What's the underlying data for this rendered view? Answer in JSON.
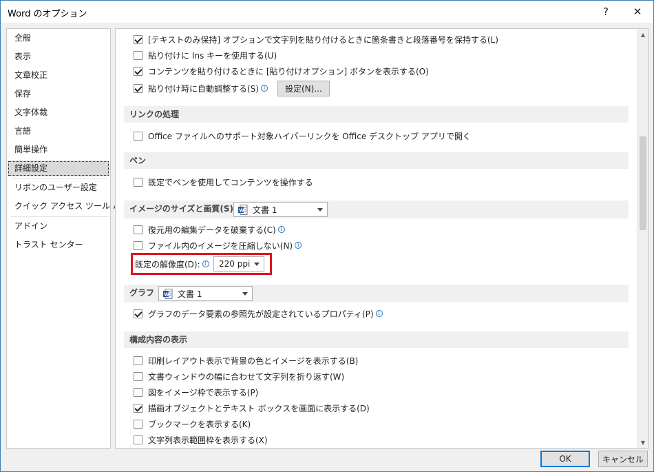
{
  "window": {
    "title": "Word のオプション",
    "help": "?",
    "close": "✕"
  },
  "sidebar": {
    "items": [
      {
        "label": "全般"
      },
      {
        "label": "表示"
      },
      {
        "label": "文章校正"
      },
      {
        "label": "保存"
      },
      {
        "label": "文字体裁"
      },
      {
        "label": "言語"
      },
      {
        "label": "簡単操作"
      },
      {
        "label": "詳細設定",
        "selected": true
      },
      {
        "label": "リボンのユーザー設定"
      },
      {
        "label": "クイック アクセス ツール バー"
      },
      {
        "label": "アドイン"
      },
      {
        "label": "トラスト センター"
      }
    ]
  },
  "main": {
    "paste": {
      "keep_bullets": {
        "label": "[テキストのみ保持] オプションで文字列を貼り付けるときに箇条書きと段落番号を保持する(L)",
        "checked": true
      },
      "ins_key": {
        "label": "貼り付けに Ins キーを使用する(U)",
        "checked": false
      },
      "show_paste_options": {
        "label": "コンテンツを貼り付けるときに [貼り付けオプション] ボタンを表示する(O)",
        "checked": true
      },
      "smart_cut": {
        "label": "貼り付け時に自動調整する(S)",
        "checked": true
      },
      "settings_button": "設定(N)..."
    },
    "link": {
      "header": "リンクの処理",
      "open_office": {
        "label": "Office ファイルへのサポート対象ハイパーリンクを Office デスクトップ アプリで開く",
        "checked": false
      }
    },
    "pen": {
      "header": "ペン",
      "use_pen": {
        "label": "既定でペンを使用してコンテンツを操作する",
        "checked": false
      }
    },
    "image": {
      "header": "イメージのサイズと画質(S)",
      "document": "文書 1",
      "discard_edit": {
        "label": "復元用の編集データを破棄する(C)",
        "checked": false
      },
      "no_compress": {
        "label": "ファイル内のイメージを圧縮しない(N)",
        "checked": false
      },
      "resolution_label": "既定の解像度(D):",
      "resolution_value": "220 ppi"
    },
    "chart": {
      "header": "グラフ",
      "document": "文書 1",
      "properties_follow": {
        "label": "グラフのデータ要素の参照先が設定されているプロパティ(P)",
        "checked": true
      }
    },
    "display": {
      "header": "構成内容の表示",
      "items": [
        {
          "label": "印刷レイアウト表示で背景の色とイメージを表示する(B)",
          "checked": false
        },
        {
          "label": "文書ウィンドウの幅に合わせて文字列を折り返す(W)",
          "checked": false
        },
        {
          "label": "図をイメージ枠で表示する(P)",
          "checked": false
        },
        {
          "label": "描画オブジェクトとテキスト ボックスを画面に表示する(D)",
          "checked": true
        },
        {
          "label": "ブックマークを表示する(K)",
          "checked": false
        },
        {
          "label": "文字列表示範囲枠を表示する(X)",
          "checked": false
        }
      ]
    }
  },
  "footer": {
    "ok": "OK",
    "cancel": "キャンセル"
  },
  "colors": {
    "accent": "#0078d7",
    "highlight": "#e0141e",
    "info": "#2f6fb7"
  }
}
